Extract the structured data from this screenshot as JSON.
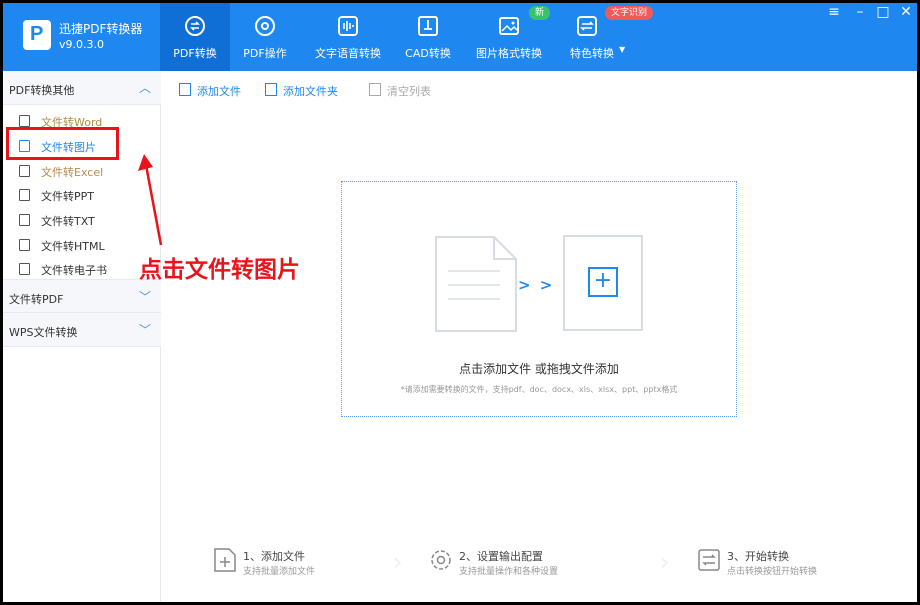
{
  "app": {
    "name": "迅捷PDF转换器",
    "version": "v9.0.3.0"
  },
  "tabs": [
    {
      "label": "PDF转换",
      "icon": "pdf-convert-icon"
    },
    {
      "label": "PDF操作",
      "icon": "pdf-operate-icon"
    },
    {
      "label": "文字语音转换",
      "icon": "voice-wave-icon"
    },
    {
      "label": "CAD转换",
      "icon": "cad-icon"
    },
    {
      "label": "图片格式转换",
      "icon": "image-icon"
    },
    {
      "label": "特色转换",
      "icon": "swap-icon"
    }
  ],
  "badges": {
    "new": "新",
    "ocr": "文字识别"
  },
  "window": {
    "menu": "≡",
    "minimize": "–",
    "maximize": "□",
    "close": "✕"
  },
  "sidebar": {
    "groups": [
      {
        "title": "PDF转换其他",
        "expanded": true
      },
      {
        "title": "文件转PDF",
        "expanded": false
      },
      {
        "title": "WPS文件转换",
        "expanded": false
      }
    ],
    "items": [
      {
        "label": "文件转Word"
      },
      {
        "label": "文件转图片"
      },
      {
        "label": "文件转Excel"
      },
      {
        "label": "文件转PPT"
      },
      {
        "label": "文件转TXT"
      },
      {
        "label": "文件转HTML"
      },
      {
        "label": "文件转电子书"
      }
    ]
  },
  "toolbar": {
    "add_file": "添加文件",
    "add_folder": "添加文件夹",
    "clear_list": "清空列表"
  },
  "dropzone": {
    "title": "点击添加文件 或拖拽文件添加",
    "subtitle": "*请添加需要转换的文件，支持pdf、doc、docx、xls、xlsx、ppt、pptx格式",
    "arrows": "> > >",
    "plus": "+"
  },
  "steps": [
    {
      "title": "1、添加文件",
      "subtitle": "支持批量添加文件",
      "icon": "add-file-icon"
    },
    {
      "title": "2、设置输出配置",
      "subtitle": "支持批量操作和各种设置",
      "icon": "settings-gear-icon"
    },
    {
      "title": "3、开始转换",
      "subtitle": "点击转换按钮开始转换",
      "icon": "convert-cycle-icon"
    }
  ],
  "annotation": {
    "text": "点击文件转图片"
  },
  "colors": {
    "brand": "#1e88f0",
    "brand_dark": "#0f6fd6",
    "annotation": "#e8141c",
    "new_badge": "#39c26a",
    "ocr_badge": "#f25a5a"
  }
}
